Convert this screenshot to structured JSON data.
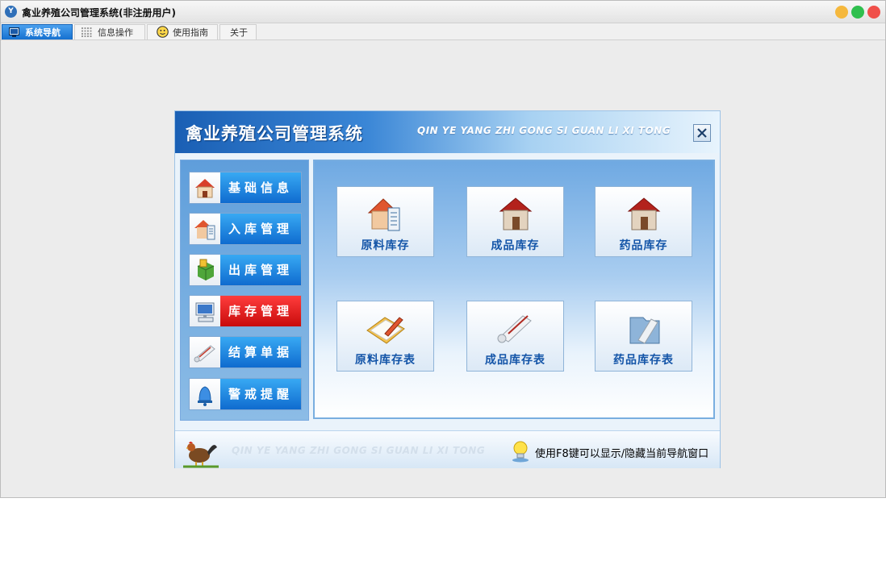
{
  "window": {
    "app_icon_text": "Y",
    "title": "禽业养殖公司管理系统(非注册用户)",
    "controls": {
      "minimize_color": "#f5b83d",
      "maximize_color": "#2fbf4e",
      "close_color": "#f0504a"
    }
  },
  "tabs": [
    {
      "label": "系统导航",
      "icon": "monitor-icon",
      "active": true
    },
    {
      "label": "信息操作",
      "icon": "grid-icon",
      "active": false
    },
    {
      "label": "使用指南",
      "icon": "smiley-icon",
      "active": false
    },
    {
      "label": "关于",
      "icon": "",
      "active": false
    }
  ],
  "panel": {
    "title": "禽业养殖公司管理系统",
    "pinyin": "QIN YE YANG ZHI GONG SI GUAN LI XI TONG"
  },
  "nav_buttons": [
    {
      "label": "基础信息",
      "icon": "house-icon",
      "active": false
    },
    {
      "label": "入库管理",
      "icon": "house-document-icon",
      "active": false
    },
    {
      "label": "出库管理",
      "icon": "package-icon",
      "active": false
    },
    {
      "label": "库存管理",
      "icon": "computer-icon",
      "active": true
    },
    {
      "label": "结算单据",
      "icon": "scroll-icon",
      "active": false
    },
    {
      "label": "警戒提醒",
      "icon": "bell-icon",
      "active": false
    }
  ],
  "tiles": [
    {
      "label": "原料库存",
      "icon": "house-document-icon"
    },
    {
      "label": "成品库存",
      "icon": "house-icon"
    },
    {
      "label": "药品库存",
      "icon": "house-icon"
    },
    {
      "label": "原料库存表",
      "icon": "notepad-pencil-icon"
    },
    {
      "label": "成品库存表",
      "icon": "scroll-pen-icon"
    },
    {
      "label": "药品库存表",
      "icon": "folder-scroll-icon"
    }
  ],
  "footer": {
    "pinyin": "QIN YE YANG ZHI GONG SI GUAN LI XI TONG",
    "hint": "使用F8键可以显示/隐藏当前导航窗口"
  },
  "colors": {
    "accent_blue": "#1570d0",
    "active_red": "#c80b0b",
    "tile_label": "#1455a8"
  }
}
